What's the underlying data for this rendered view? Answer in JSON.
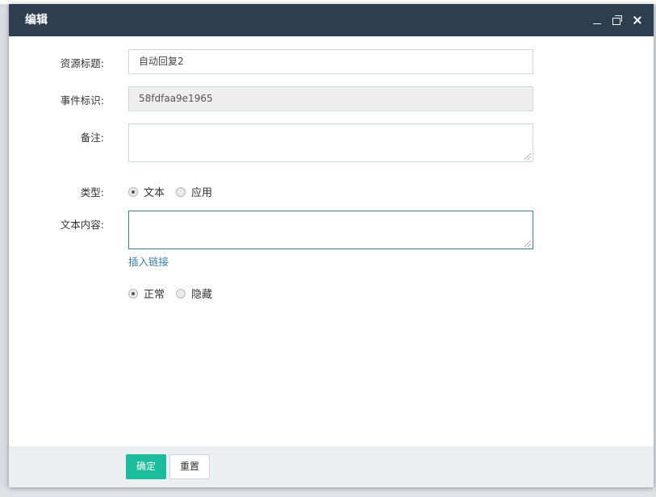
{
  "dialog": {
    "title": "编辑"
  },
  "form": {
    "title_label": "资源标题:",
    "title_value": "自动回复2",
    "event_label": "事件标识:",
    "event_value": "58fdfaa9e1965",
    "note_label": "备注:",
    "note_value": "",
    "type_label": "类型:",
    "type_options": [
      "文本",
      "应用"
    ],
    "type_selected": "文本",
    "content_label": "文本内容:",
    "content_value": "",
    "insert_link": "插入链接",
    "status_options": [
      "正常",
      "隐藏"
    ],
    "status_selected": "正常"
  },
  "footer": {
    "ok_label": "确定",
    "reset_label": "重置"
  },
  "colors": {
    "titlebar": "#2c3e50",
    "primary_button": "#1abc9c",
    "link": "#3c7ea8"
  }
}
